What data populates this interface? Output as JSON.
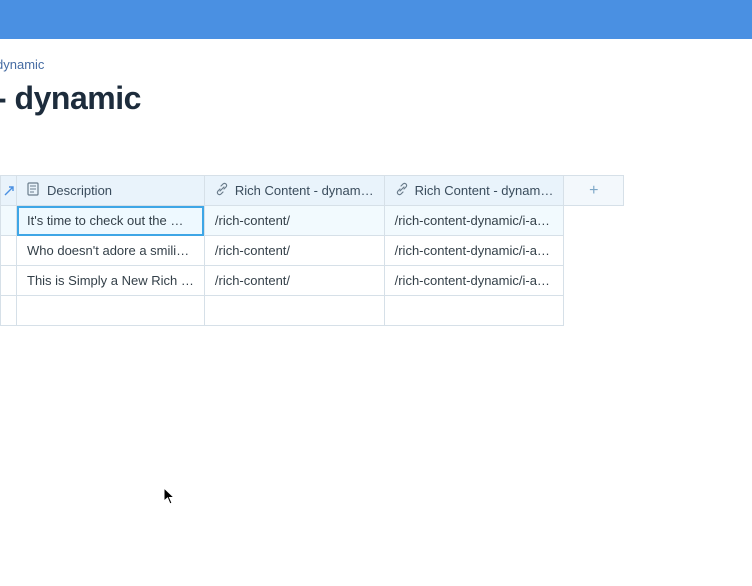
{
  "breadcrumb": "dynamic",
  "page_title": "- dynamic",
  "table": {
    "headers": {
      "description": "Description",
      "link1": "Rich Content - dynam…",
      "link2": "Rich Content - dynam…"
    },
    "rows": [
      {
        "description": "It's time to check out the …",
        "link1": "/rich-content/",
        "link2": "/rich-content-dynamic/i-a…"
      },
      {
        "description": "Who doesn't adore a smili…",
        "link1": "/rich-content/",
        "link2": "/rich-content-dynamic/i-a…"
      },
      {
        "description": "This is Simply a New Rich …",
        "link1": "/rich-content/",
        "link2": "/rich-content-dynamic/i-a…"
      }
    ]
  }
}
